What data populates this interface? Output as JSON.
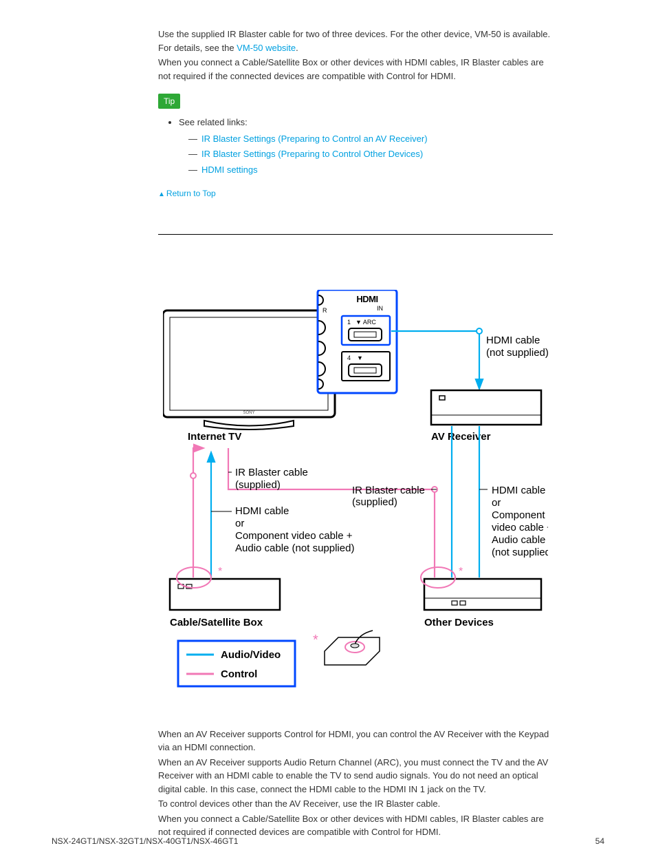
{
  "intro": {
    "p1a": "Use the supplied IR Blaster cable for two of three devices. For the other device, VM-50 is available. For details, see the ",
    "p1_link": "VM-50 website",
    "p1b": ".",
    "p2": "When you connect a Cable/Satellite Box or other devices with HDMI cables, IR Blaster cables are not required if the connected devices are compatible with Control for HDMI."
  },
  "tip": {
    "badge": "Tip",
    "bullet_label": "See related links:",
    "links": {
      "l1": "IR Blaster Settings (Preparing to Control an AV Receiver)",
      "l2": "IR Blaster Settings (Preparing to Control Other Devices)",
      "l3": "HDMI settings"
    }
  },
  "return_top": "Return to Top",
  "diagram": {
    "hdmi_logo_in": "IN",
    "port1": "1",
    "port1_arc": "▼ ARC",
    "port4": "4",
    "port4_arrow": "▼",
    "label_hdmi_cable_ns": "HDMI cable (not supplied)",
    "label_internet_tv": "Internet TV",
    "label_av_receiver": "AV Receiver",
    "label_ir_blaster_supplied": "IR Blaster cable (supplied)",
    "label_ir_blaster_supplied2": "IR Blaster cable (supplied)",
    "label_hdmi_or_component": "HDMI cable\nor\nComponent video cable + Audio cable (not supplied)",
    "label_hdmi_or_component2": "HDMI cable\nor\nComponent video cable + Audio cable (not supplied)",
    "label_cable_sat": "Cable/Satellite Box",
    "label_other_devices": "Other Devices",
    "legend_av": "Audio/Video",
    "legend_ctrl": "Control"
  },
  "body2": {
    "p1": "When an AV Receiver supports Control for HDMI, you can control the AV Receiver with the Keypad via an HDMI connection.",
    "p2": "When an AV Receiver supports Audio Return Channel (ARC), you must connect the TV and the AV Receiver with an HDMI cable to enable the TV to send audio signals. You do not need an optical digital cable. In this case, connect the HDMI cable to the HDMI IN 1 jack on the TV.",
    "p3": "To control devices other than the AV Receiver, use the IR Blaster cable.",
    "p4": "When you connect a Cable/Satellite Box or other devices with HDMI cables, IR Blaster cables are not required if connected devices are compatible with Control for HDMI."
  },
  "footer": {
    "models": "NSX-24GT1/NSX-32GT1/NSX-40GT1/NSX-46GT1",
    "page": "54"
  }
}
